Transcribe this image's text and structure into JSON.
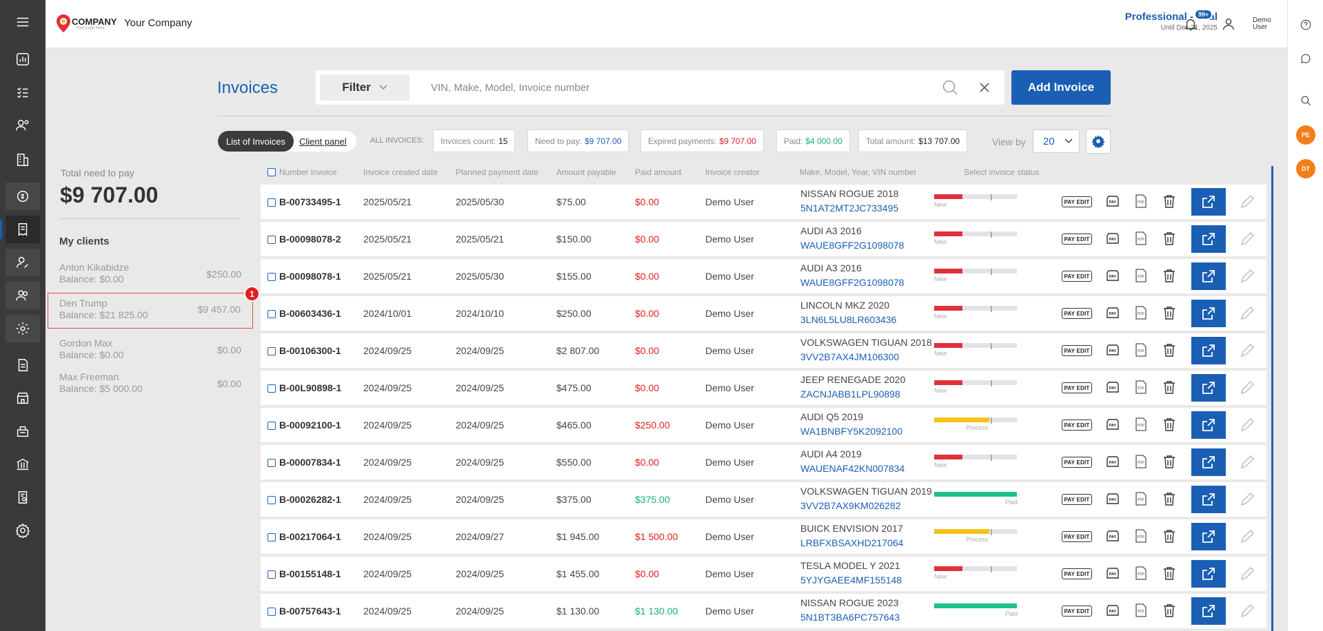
{
  "header": {
    "logo_text": "COMPANY",
    "logo_sub": "Your Logo Here",
    "company_name": "Your Company",
    "plan_title": "Professional - Trial",
    "plan_until": "Until Dec 31, 2025",
    "notif_count": "99+",
    "user_name_line1": "Demo",
    "user_name_line2": "User"
  },
  "right_rail": {
    "avatars": [
      "PE",
      "DT"
    ]
  },
  "page": {
    "title": "Invoices",
    "filter_label": "Filter",
    "search_placeholder": "VIN, Make, Model, Invoice number",
    "add_button": "Add Invoice",
    "tab_list": "List of Invoices",
    "tab_client": "Client panel",
    "all_invoices_label": "ALL INVOICES:",
    "stats": [
      {
        "label": "Invoices count:",
        "value": "15",
        "color": "#222222"
      },
      {
        "label": "Need to pay:",
        "value": "$9 707.00",
        "color": "#1a5fb4"
      },
      {
        "label": "Expired payments:",
        "value": "$9 707.00",
        "color": "#e02020"
      },
      {
        "label": "Paid:",
        "value": "$4 000.00",
        "color": "#1cae7a"
      },
      {
        "label": "Total amount:",
        "value": "$13 707.00",
        "color": "#222222"
      }
    ],
    "view_by_label": "View by",
    "view_by_value": "20"
  },
  "sidebar": {
    "total_label": "Total need to pay",
    "total_value": "$9 707.00",
    "clients_title": "My clients",
    "clients": [
      {
        "name": "Anton Kikabidze",
        "balance": "Balance: $0.00",
        "amount": "$250.00"
      },
      {
        "name": "Den Trump",
        "balance": "Balance: $21 825.00",
        "amount": "$9 457.00"
      },
      {
        "name": "Gordon Max",
        "balance": "Balance: $0.00",
        "amount": "$0.00"
      },
      {
        "name": "Max Freeman",
        "balance": "Balance: $5 000.00",
        "amount": "$0.00"
      }
    ],
    "marker": "1"
  },
  "table": {
    "headers": [
      "Number invoice",
      "Invoice created date",
      "Planned payment date",
      "Amount payable",
      "Paid amount",
      "Invoice creator",
      "Make, Model, Year, VIN number",
      "Select invoice status"
    ],
    "action_labels": {
      "pay_edit": "PAY EDIT",
      "pay": "PAY",
      "pdf": "PDF"
    },
    "status_colors": {
      "New": "#e0303a",
      "Process": "#f5c21b",
      "Paid": "#1cc08c"
    },
    "rows": [
      {
        "number": "B-00733495-1",
        "created": "2025/05/21",
        "planned": "2025/05/30",
        "amount": "$75.00",
        "paid": "$0.00",
        "paid_color": "red",
        "creator": "Demo User",
        "make": "NISSAN ROGUE 2018",
        "vin": "5N1AT2MT2JC733495",
        "status": "New"
      },
      {
        "number": "B-00098078-2",
        "created": "2025/05/21",
        "planned": "2025/05/21",
        "amount": "$150.00",
        "paid": "$0.00",
        "paid_color": "red",
        "creator": "Demo User",
        "make": "AUDI A3 2016",
        "vin": "WAUE8GFF2G1098078",
        "status": "New"
      },
      {
        "number": "B-00098078-1",
        "created": "2025/05/21",
        "planned": "2025/05/30",
        "amount": "$155.00",
        "paid": "$0.00",
        "paid_color": "red",
        "creator": "Demo User",
        "make": "AUDI A3 2016",
        "vin": "WAUE8GFF2G1098078",
        "status": "New"
      },
      {
        "number": "B-00603436-1",
        "created": "2024/10/01",
        "planned": "2024/10/10",
        "amount": "$250.00",
        "paid": "$0.00",
        "paid_color": "red",
        "creator": "Demo User",
        "make": "LINCOLN MKZ 2020",
        "vin": "3LN6L5LU8LR603436",
        "status": "New"
      },
      {
        "number": "B-00106300-1",
        "created": "2024/09/25",
        "planned": "2024/09/25",
        "amount": "$2 807.00",
        "paid": "$0.00",
        "paid_color": "red",
        "creator": "Demo User",
        "make": "VOLKSWAGEN TIGUAN 2018",
        "vin": "3VV2B7AX4JM106300",
        "status": "New"
      },
      {
        "number": "B-00L90898-1",
        "created": "2024/09/25",
        "planned": "2024/09/25",
        "amount": "$475.00",
        "paid": "$0.00",
        "paid_color": "red",
        "creator": "Demo User",
        "make": "JEEP RENEGADE 2020",
        "vin": "ZACNJABB1LPL90898",
        "status": "New"
      },
      {
        "number": "B-00092100-1",
        "created": "2024/09/25",
        "planned": "2024/09/25",
        "amount": "$465.00",
        "paid": "$250.00",
        "paid_color": "red",
        "creator": "Demo User",
        "make": "AUDI Q5 2019",
        "vin": "WA1BNBFY5K2092100",
        "status": "Process"
      },
      {
        "number": "B-00007834-1",
        "created": "2024/09/25",
        "planned": "2024/09/25",
        "amount": "$550.00",
        "paid": "$0.00",
        "paid_color": "red",
        "creator": "Demo User",
        "make": "AUDI A4 2019",
        "vin": "WAUENAF42KN007834",
        "status": "New"
      },
      {
        "number": "B-00026282-1",
        "created": "2024/09/25",
        "planned": "2024/09/25",
        "amount": "$375.00",
        "paid": "$375.00",
        "paid_color": "green",
        "creator": "Demo User",
        "make": "VOLKSWAGEN TIGUAN 2019",
        "vin": "3VV2B7AX9KM026282",
        "status": "Paid"
      },
      {
        "number": "B-00217064-1",
        "created": "2024/09/25",
        "planned": "2024/09/27",
        "amount": "$1 945.00",
        "paid": "$1 500.00",
        "paid_color": "red",
        "creator": "Demo User",
        "make": "BUICK ENVISION 2017",
        "vin": "LRBFXBSAXHD217064",
        "status": "Process"
      },
      {
        "number": "B-00155148-1",
        "created": "2024/09/25",
        "planned": "2024/09/25",
        "amount": "$1 455.00",
        "paid": "$0.00",
        "paid_color": "red",
        "creator": "Demo User",
        "make": "TESLA MODEL Y 2021",
        "vin": "5YJYGAEE4MF155148",
        "status": "New"
      },
      {
        "number": "B-00757643-1",
        "created": "2024/09/25",
        "planned": "2024/09/25",
        "amount": "$1 130.00",
        "paid": "$1 130.00",
        "paid_color": "green",
        "creator": "Demo User",
        "make": "NISSAN ROGUE 2023",
        "vin": "5N1BT3BA6PC757643",
        "status": "Paid"
      }
    ]
  }
}
